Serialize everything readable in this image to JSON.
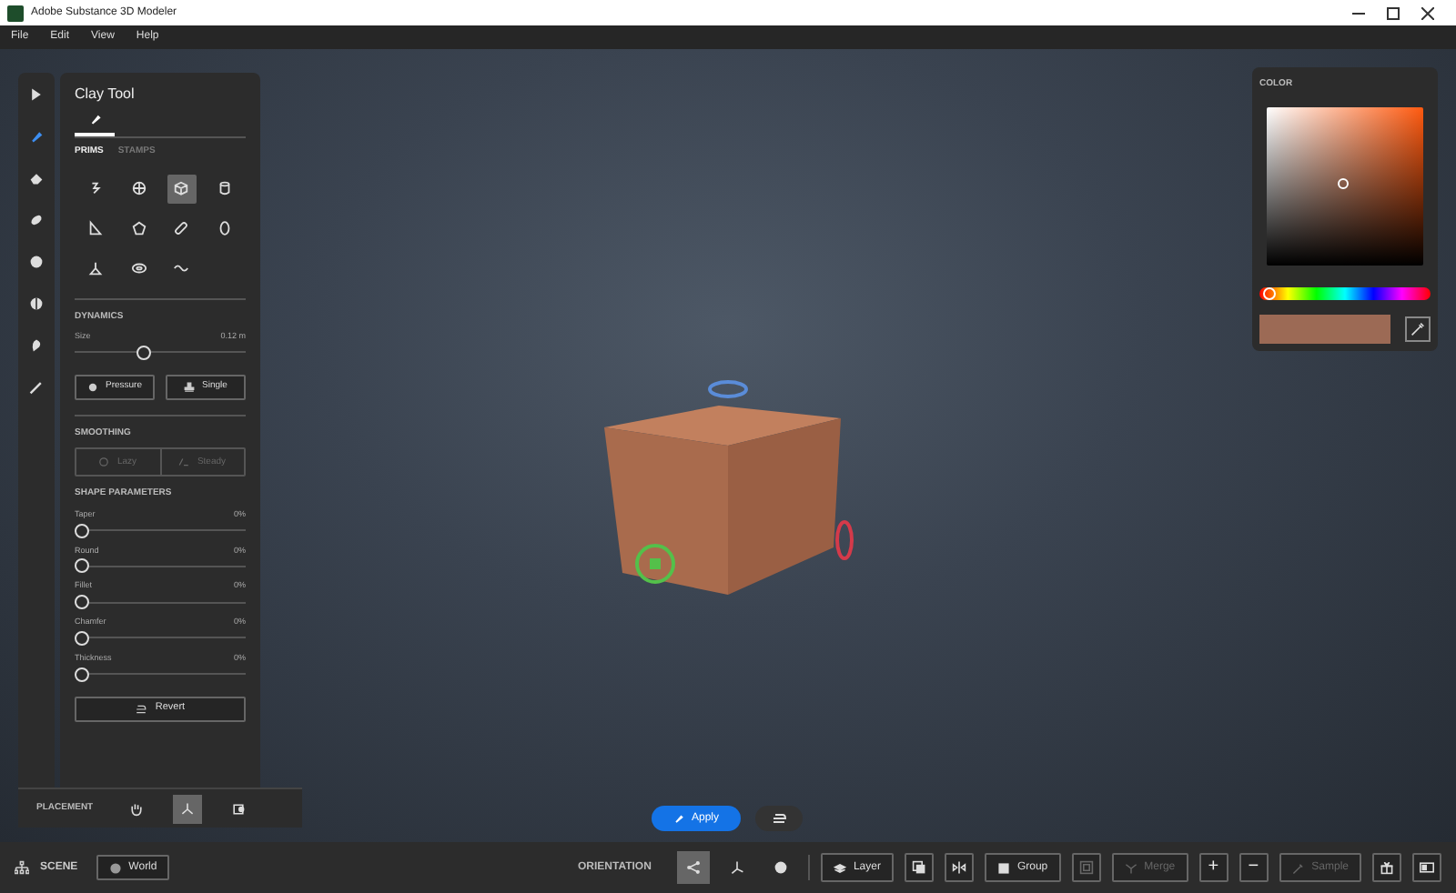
{
  "window": {
    "title": "Adobe Substance 3D Modeler"
  },
  "menu": [
    "File",
    "Edit",
    "View",
    "Help"
  ],
  "tools": [
    {
      "selected": false
    },
    {
      "selected": true
    },
    {
      "selected": false
    },
    {
      "selected": false
    },
    {
      "selected": false
    },
    {
      "selected": false
    },
    {
      "selected": false
    },
    {
      "selected": false
    }
  ],
  "clay_panel": {
    "title": "Clay Tool",
    "tabs": [
      {
        "label": "PRIMS",
        "selected": true
      },
      {
        "label": "STAMPS",
        "selected": false
      }
    ],
    "prims": [
      {
        "selected": false
      },
      {
        "selected": false
      },
      {
        "selected": true
      },
      {
        "selected": false
      },
      {
        "selected": false
      },
      {
        "selected": false
      },
      {
        "selected": false
      },
      {
        "selected": false
      },
      {
        "selected": false
      },
      {
        "selected": false
      },
      {
        "selected": false
      }
    ],
    "dynamics": {
      "heading": "DYNAMICS",
      "size": {
        "label": "Size",
        "reading": "0.12 m",
        "level": 0.4
      },
      "buttons": [
        {
          "label": "Pressure",
          "kind": "pressure"
        },
        {
          "label": "Single",
          "kind": "single"
        }
      ]
    },
    "smoothing": {
      "heading": "SMOOTHING",
      "buttons": [
        {
          "label": "Lazy",
          "disabled": true
        },
        {
          "label": "Steady",
          "disabled": true
        }
      ]
    },
    "shape_parameters": {
      "heading": "SHAPE PARAMETERS",
      "sliders": [
        {
          "label": "Taper",
          "reading": "0%",
          "level": 0
        },
        {
          "label": "Round",
          "reading": "0%",
          "level": 0
        },
        {
          "label": "Fillet",
          "reading": "0%",
          "level": 0
        },
        {
          "label": "Chamfer",
          "reading": "0%",
          "level": 0
        },
        {
          "label": "Thickness",
          "reading": "0%",
          "level": 0
        }
      ]
    },
    "revert": "Revert",
    "placement": {
      "label": "PLACEMENT",
      "options": [
        {
          "selected": false
        },
        {
          "selected": true
        },
        {
          "selected": false
        }
      ]
    }
  },
  "color_panel": {
    "heading": "COLOR",
    "hue": {
      "level": 0.02
    }
  },
  "viewport": {
    "apply": "Apply"
  },
  "status_bar": {
    "scene": "SCENE",
    "world": "World",
    "orientation": "ORIENTATION",
    "orientation_options": [
      {
        "selected": true
      },
      {
        "selected": false
      },
      {
        "selected": false
      }
    ],
    "tools": [
      {
        "kind": "labeled",
        "label": "Layer",
        "disabled": false
      },
      {
        "kind": "icon",
        "disabled": false
      },
      {
        "kind": "icon",
        "disabled": false
      },
      {
        "kind": "labeled",
        "label": "Group",
        "disabled": false
      },
      {
        "kind": "icon",
        "disabled": true
      },
      {
        "kind": "labeled",
        "label": "Merge",
        "disabled": true
      },
      {
        "kind": "glyph",
        "label": "+",
        "disabled": false
      },
      {
        "kind": "glyph",
        "label": "−",
        "disabled": false
      },
      {
        "kind": "labeled",
        "label": "Sample",
        "disabled": true
      },
      {
        "kind": "icon",
        "disabled": false
      },
      {
        "kind": "icon",
        "disabled": false
      }
    ]
  }
}
